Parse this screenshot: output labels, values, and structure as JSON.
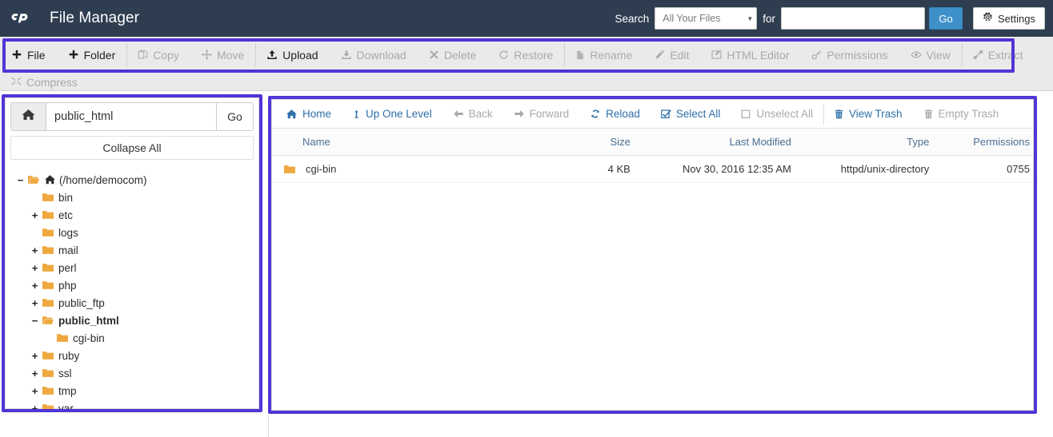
{
  "header": {
    "app_title": "File Manager",
    "logo_icon": "cpanel-logo",
    "search_label": "Search",
    "search_scope_selected": "All Your Files",
    "search_scope_options": [
      "All Your Files"
    ],
    "for_label": "for",
    "search_value": "",
    "search_placeholder": "",
    "go_label": "Go",
    "settings_label": "Settings",
    "settings_icon": "gear-icon",
    "bg_color": "#2e3e50",
    "go_color": "#3e90c9"
  },
  "toolbar": {
    "highlight_color": "#5334d6",
    "items": [
      {
        "label": "File",
        "icon": "plus-icon",
        "disabled": false,
        "separator": false
      },
      {
        "label": "Folder",
        "icon": "plus-icon",
        "disabled": false,
        "separator": false
      },
      {
        "label": "Copy",
        "icon": "copy-icon",
        "disabled": true,
        "separator": true
      },
      {
        "label": "Move",
        "icon": "move-icon",
        "disabled": true,
        "separator": false
      },
      {
        "label": "Upload",
        "icon": "upload-icon",
        "disabled": false,
        "separator": true
      },
      {
        "label": "Download",
        "icon": "download-icon",
        "disabled": true,
        "separator": false
      },
      {
        "label": "Delete",
        "icon": "close-x-icon",
        "disabled": true,
        "separator": false
      },
      {
        "label": "Restore",
        "icon": "restore-icon",
        "disabled": true,
        "separator": false
      },
      {
        "label": "Rename",
        "icon": "file-icon",
        "disabled": true,
        "separator": true
      },
      {
        "label": "Edit",
        "icon": "pencil-icon",
        "disabled": true,
        "separator": false
      },
      {
        "label": "HTML Editor",
        "icon": "editor-icon",
        "disabled": true,
        "separator": false
      },
      {
        "label": "Permissions",
        "icon": "key-icon",
        "disabled": true,
        "separator": false
      },
      {
        "label": "View",
        "icon": "eye-icon",
        "disabled": true,
        "separator": false
      },
      {
        "label": "Extract",
        "icon": "extract-icon",
        "disabled": true,
        "separator": true
      }
    ],
    "compress": {
      "label": "Compress",
      "icon": "compress-icon",
      "disabled": true
    }
  },
  "sidebar": {
    "home_icon": "home-icon",
    "path_value": "public_html",
    "go_label": "Go",
    "collapse_all_label": "Collapse All",
    "tree": [
      {
        "label": "(/home/democom)",
        "toggle": "−",
        "indent": 0,
        "bold": false,
        "home": true,
        "open": true
      },
      {
        "label": "bin",
        "toggle": "",
        "indent": 1,
        "bold": false,
        "home": false,
        "open": false
      },
      {
        "label": "etc",
        "toggle": "+",
        "indent": 1,
        "bold": false,
        "home": false,
        "open": false
      },
      {
        "label": "logs",
        "toggle": "",
        "indent": 1,
        "bold": false,
        "home": false,
        "open": false
      },
      {
        "label": "mail",
        "toggle": "+",
        "indent": 1,
        "bold": false,
        "home": false,
        "open": false
      },
      {
        "label": "perl",
        "toggle": "+",
        "indent": 1,
        "bold": false,
        "home": false,
        "open": false
      },
      {
        "label": "php",
        "toggle": "+",
        "indent": 1,
        "bold": false,
        "home": false,
        "open": false
      },
      {
        "label": "public_ftp",
        "toggle": "+",
        "indent": 1,
        "bold": false,
        "home": false,
        "open": false
      },
      {
        "label": "public_html",
        "toggle": "−",
        "indent": 1,
        "bold": true,
        "home": false,
        "open": true
      },
      {
        "label": "cgi-bin",
        "toggle": "",
        "indent": 2,
        "bold": false,
        "home": false,
        "open": false
      },
      {
        "label": "ruby",
        "toggle": "+",
        "indent": 1,
        "bold": false,
        "home": false,
        "open": false
      },
      {
        "label": "ssl",
        "toggle": "+",
        "indent": 1,
        "bold": false,
        "home": false,
        "open": false
      },
      {
        "label": "tmp",
        "toggle": "+",
        "indent": 1,
        "bold": false,
        "home": false,
        "open": false
      },
      {
        "label": "var",
        "toggle": "+",
        "indent": 1,
        "bold": false,
        "home": false,
        "open": false
      }
    ]
  },
  "filepane": {
    "nav": [
      {
        "label": "Home",
        "icon": "home-icon",
        "disabled": false,
        "separator": false
      },
      {
        "label": "Up One Level",
        "icon": "up-arrow-icon",
        "disabled": false,
        "separator": false
      },
      {
        "label": "Back",
        "icon": "arrow-left-icon",
        "disabled": true,
        "separator": false
      },
      {
        "label": "Forward",
        "icon": "arrow-right-icon",
        "disabled": true,
        "separator": false
      },
      {
        "label": "Reload",
        "icon": "reload-icon",
        "disabled": false,
        "separator": false
      },
      {
        "label": "Select All",
        "icon": "checkbox-checked-icon",
        "disabled": false,
        "separator": false
      },
      {
        "label": "Unselect All",
        "icon": "checkbox-empty-icon",
        "disabled": true,
        "separator": false
      },
      {
        "label": "View Trash",
        "icon": "trash-icon",
        "disabled": false,
        "separator": true
      },
      {
        "label": "Empty Trash",
        "icon": "trash-icon",
        "disabled": true,
        "separator": false
      }
    ],
    "columns": [
      "Name",
      "Size",
      "Last Modified",
      "Type",
      "Permissions"
    ],
    "rows": [
      {
        "icon": "folder-icon",
        "name": "cgi-bin",
        "size": "4 KB",
        "modified": "Nov 30, 2016 12:35 AM",
        "type": "httpd/unix-directory",
        "permissions": "0755"
      }
    ]
  }
}
